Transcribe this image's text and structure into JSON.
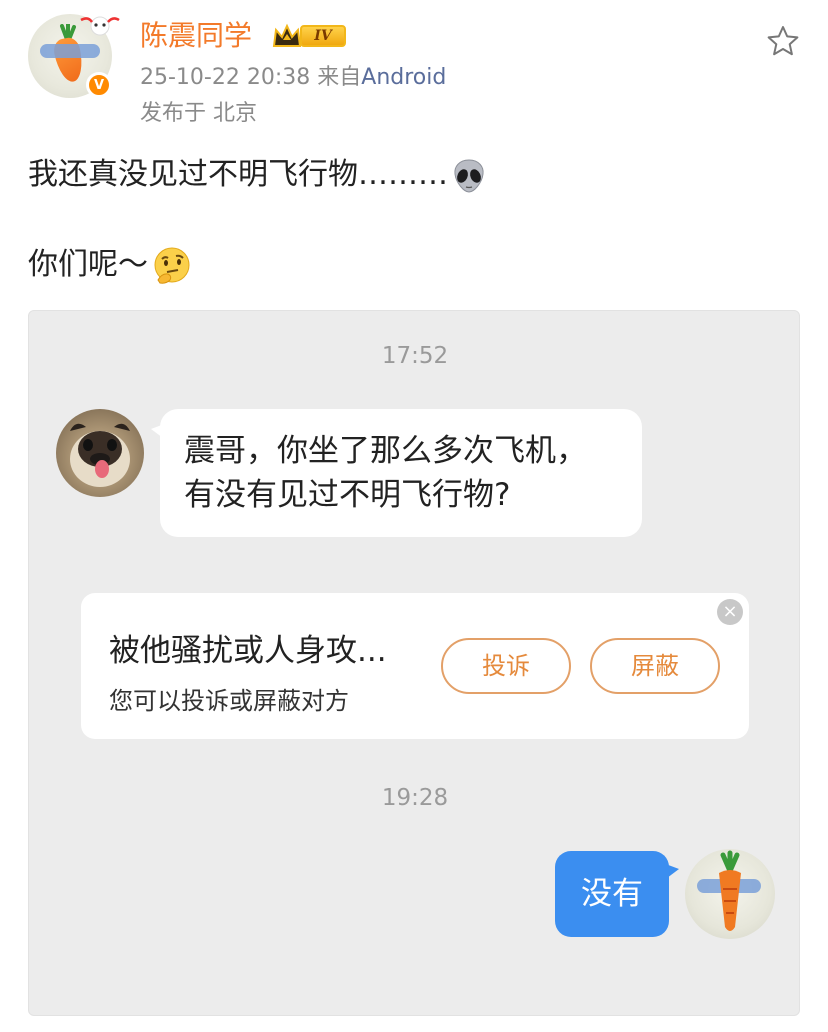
{
  "post": {
    "author": "陈震同学",
    "vip_level": "IV",
    "date": "25-10-22 20:38",
    "from_prefix": "来自",
    "source": "Android",
    "location": "发布于 北京",
    "text_line1": "我还真没见过不明飞行物………",
    "text_line2": "你们呢～",
    "icons": {
      "favorite": "star-outline-icon",
      "verified": "verified-v-badge",
      "emoji1": "alien-emoji",
      "emoji2": "thinking-emoji"
    },
    "colors": {
      "author": "#f37a2a",
      "source": "#5a6d9b",
      "verified": "#ff8a00"
    }
  },
  "chat": {
    "time1": "17:52",
    "incoming_line1": "震哥，你坐了那么多次飞机，",
    "incoming_line2": "有没有见过不明飞行物?",
    "report": {
      "title": "被他骚扰或人身攻...",
      "description": "您可以投诉或屏蔽对方",
      "report_button": "投诉",
      "block_button": "屏蔽"
    },
    "time2": "19:28",
    "outgoing": "没有",
    "colors": {
      "outgoing_bubble": "#3b8ef0",
      "pill_border": "#e3a068"
    }
  }
}
